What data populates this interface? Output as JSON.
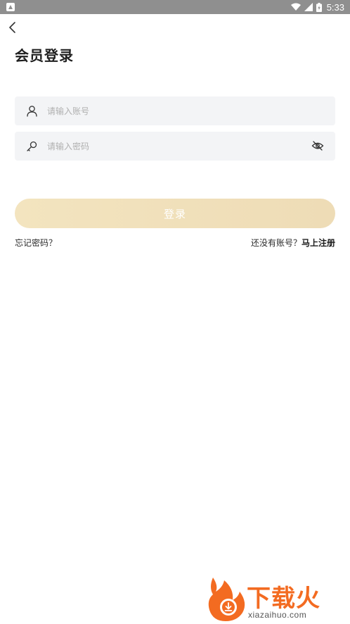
{
  "status_bar": {
    "time": "5:33"
  },
  "header": {
    "title": "会员登录"
  },
  "form": {
    "account_placeholder": "请输入账号",
    "password_placeholder": "请输入密码",
    "login_label": "登录"
  },
  "links": {
    "forgot": "忘记密码？",
    "no_account": "还没有账号？",
    "register": "马上注册"
  },
  "watermark": {
    "brand": "下载火",
    "url": "xiazaihuo.com"
  },
  "colors": {
    "login_button": "#f1e0b9",
    "input_bg": "#f3f4f6",
    "watermark_orange": "#f36b21"
  }
}
